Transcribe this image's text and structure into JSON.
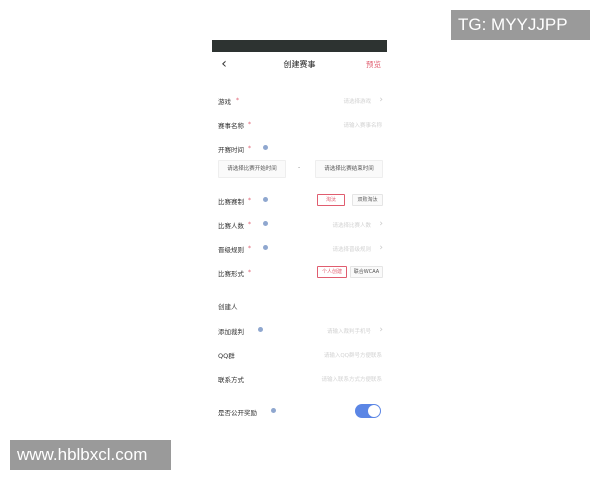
{
  "watermarks": {
    "top": "TG: MYYJJPP",
    "bottom": "www.hblbxcl.com"
  },
  "header": {
    "back_icon": "chevron-left-icon",
    "title": "创建赛事",
    "preview_label": "预览"
  },
  "form": {
    "game": {
      "label": "游戏",
      "required": "*",
      "placeholder": "请选择游戏"
    },
    "event_name": {
      "label": "赛事名称",
      "required": "*",
      "placeholder": "请输入赛事名称"
    },
    "start_time": {
      "label": "开赛时间",
      "required": "*",
      "start_button": "请选择比赛开始时间",
      "separator": "-",
      "end_button": "请选择比赛结束时间"
    },
    "format": {
      "label": "比赛赛制",
      "required": "*",
      "options": [
        "淘汰",
        "双败淘汰"
      ],
      "selected": "淘汰"
    },
    "player_count": {
      "label": "比赛人数",
      "required": "*",
      "placeholder": "请选择比赛人数"
    },
    "advance_rule": {
      "label": "晋级规则",
      "required": "*",
      "placeholder": "请选择晋级规则"
    },
    "mode": {
      "label": "比赛形式",
      "required": "*",
      "options": [
        "个人创建",
        "联合WCAA"
      ],
      "selected": "个人创建"
    },
    "creator": {
      "label": "创建人"
    },
    "referee": {
      "label": "添加裁判",
      "placeholder": "请输入裁判手机号"
    },
    "qq_group": {
      "label": "QQ群",
      "placeholder": "请输入QQ群号方便联系"
    },
    "contact": {
      "label": "联系方式",
      "placeholder": "请输入联系方式方便联系"
    },
    "public_reward": {
      "label": "是否公开奖励",
      "value": true
    }
  },
  "colors": {
    "accent": "#e05d6f",
    "toggle_on": "#5b86e5",
    "status_bar": "#2d3331",
    "info_dot": "#8fa7cf"
  }
}
